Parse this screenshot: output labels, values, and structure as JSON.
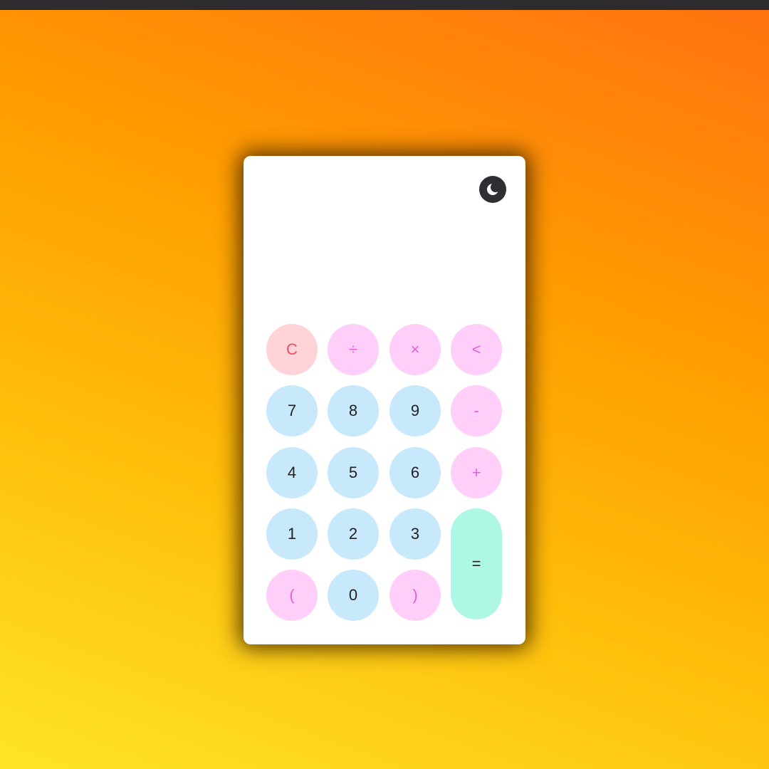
{
  "calculator": {
    "display_value": "",
    "theme_toggle_icon": "moon-icon",
    "keys": {
      "clear": "C",
      "divide": "÷",
      "multiply": "×",
      "backspace": "<",
      "seven": "7",
      "eight": "8",
      "nine": "9",
      "minus": "-",
      "four": "4",
      "five": "5",
      "six": "6",
      "plus": "+",
      "one": "1",
      "two": "2",
      "three": "3",
      "equals": "=",
      "open_paren": "(",
      "zero": "0",
      "close_paren": ")"
    }
  },
  "colors": {
    "number_key_bg": "#c8e8fb",
    "operator_key_bg": "#ffcff9",
    "operator_key_text": "#e25fd9",
    "clear_key_bg": "#ffd3d8",
    "clear_key_text": "#f0505c",
    "equals_key_bg": "#aff7e5",
    "toggle_bg": "#2f2f33"
  }
}
